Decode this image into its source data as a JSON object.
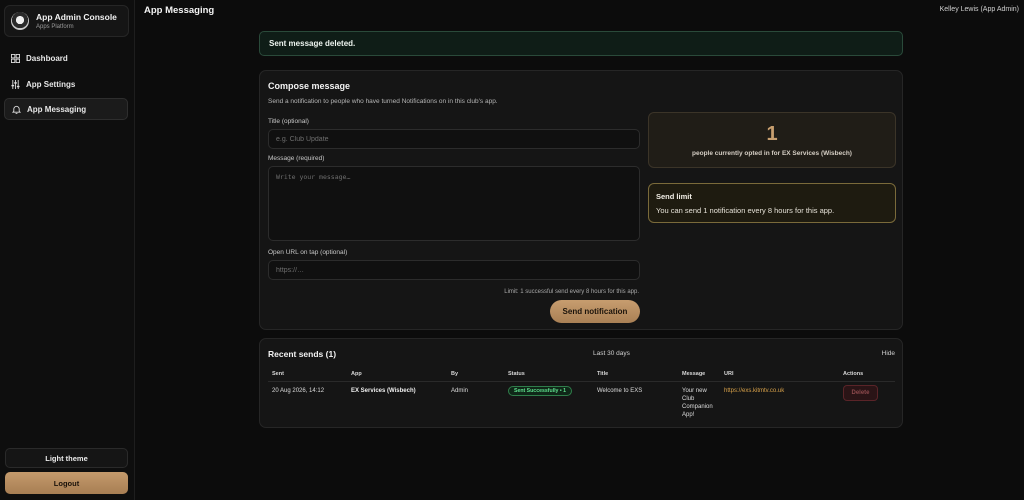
{
  "brand": {
    "title": "App Admin Console",
    "subtitle": "Apps Platform",
    "logo_icon": "club-logo-icon"
  },
  "sidebar": {
    "items": [
      {
        "label": "Dashboard",
        "icon": "grid-icon",
        "active": false
      },
      {
        "label": "App Settings",
        "icon": "sliders-icon",
        "active": false
      },
      {
        "label": "App Messaging",
        "icon": "bell-icon",
        "active": true
      }
    ],
    "theme_label": "Light theme",
    "logout_label": "Logout"
  },
  "header": {
    "title": "App Messaging",
    "user": "Kelley Lewis (App Admin)"
  },
  "alert": {
    "text": "Sent message deleted."
  },
  "compose": {
    "title": "Compose message",
    "description": "Send a notification to people who have turned Notifications on in this club's app.",
    "title_label": "Title (optional)",
    "title_placeholder": "e.g. Club Update",
    "title_value": "",
    "message_label": "Message (required)",
    "message_placeholder": "Write your message…",
    "message_value": "",
    "url_label": "Open URL on tap (optional)",
    "url_placeholder": "https://…",
    "url_value": "",
    "limit_note": "Limit: 1 successful send every 8 hours for this app.",
    "send_label": "Send notification",
    "optin_count": "1",
    "optin_text": "people currently opted in for EX Services (Wisbech)",
    "limit_title": "Send limit",
    "limit_text": "You can send 1 notification every 8 hours for this app."
  },
  "recent": {
    "title": "Recent sends (1)",
    "range": "Last 30 days",
    "hide_label": "Hide",
    "columns": [
      "Sent",
      "App",
      "By",
      "Status",
      "Title",
      "Message",
      "URI",
      "Actions"
    ],
    "rows": [
      {
        "sent": "20 Aug 2026, 14:12",
        "app": "EX Services (Wisbech)",
        "by": "Admin",
        "status": "Sent Successfully • 1",
        "title": "Welcome to EXS",
        "message": "Your new Club Companion App!",
        "uri": "https://exs.kitmtv.co.uk",
        "action": "Delete"
      }
    ]
  },
  "colors": {
    "accent": "#c49a6c",
    "success": "#5fe08e",
    "warning_border": "#7a6a3a",
    "danger": "#8d4a4d"
  }
}
